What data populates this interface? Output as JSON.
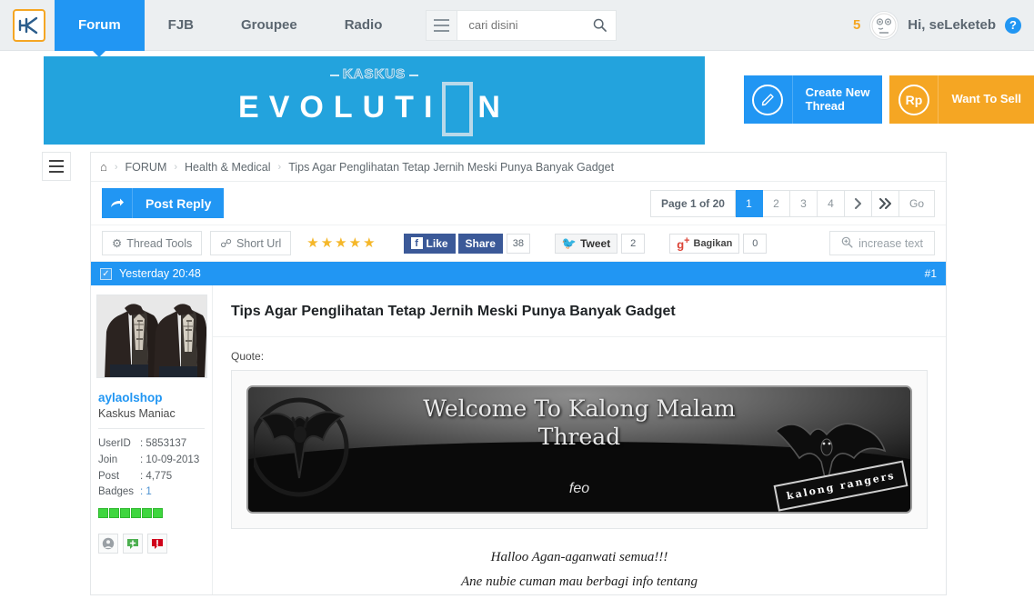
{
  "topnav": {
    "logo_alt": "KASKUS",
    "items": [
      {
        "label": "Forum",
        "active": true
      },
      {
        "label": "FJB",
        "active": false
      },
      {
        "label": "Groupee",
        "active": false
      },
      {
        "label": "Radio",
        "active": false
      }
    ],
    "menu_icon": "hamburger-icon",
    "search": {
      "value": "",
      "placeholder": "cari disini",
      "icon": "search-icon"
    },
    "notification_count": "5",
    "greeting": "Hi, seLeketeb",
    "help_label": "?",
    "avatar_icon": "user-avatar-icon"
  },
  "banner": {
    "brand_small": "KASKUS",
    "title_part1": "EVOLUTI",
    "title_part2": "N",
    "bg_color": "#23a3dd"
  },
  "actions": {
    "create_thread": {
      "label": "Create New\nThread",
      "line1": "Create New",
      "line2": "Thread",
      "icon": "pencil-icon",
      "color": "#2196f3"
    },
    "want_to_sell": {
      "label": "Want To Sell",
      "icon": "rupiah-icon",
      "icon_text": "Rp",
      "color": "#f5a623"
    }
  },
  "sidebar_toggle_icon": "hamburger-icon",
  "breadcrumb": {
    "home_icon": "home-icon",
    "items": [
      "FORUM",
      "Health & Medical",
      "Tips Agar Penglihatan Tetap Jernih Meski Punya Banyak Gadget"
    ],
    "separator": "›"
  },
  "toolbar": {
    "post_reply": {
      "label": "Post Reply",
      "icon": "reply-arrow-icon"
    },
    "pager": {
      "info": "Page 1 of 20",
      "pages": [
        "1",
        "2",
        "3",
        "4"
      ],
      "active_page": "1",
      "next_icon": "❯",
      "last_icon": "➤➤",
      "go_label": "Go"
    },
    "thread_tools": {
      "label": "Thread Tools",
      "icon": "gear-icon"
    },
    "short_url": {
      "label": "Short Url",
      "icon": "link-icon"
    },
    "rating": {
      "stars": 5,
      "filled": 5,
      "color": "#f5b729"
    },
    "facebook": {
      "like_label": "Like",
      "share_label": "Share",
      "count": "38",
      "icon": "facebook-icon"
    },
    "twitter": {
      "label": "Tweet",
      "count": "2",
      "icon": "twitter-icon"
    },
    "google": {
      "label": "Bagikan",
      "count": "0",
      "icon": "google-plus-icon"
    },
    "increase_text": {
      "label": "increase text",
      "icon": "zoom-in-icon"
    }
  },
  "post": {
    "header": {
      "timestamp": "Yesterday 20:48",
      "number": "#1",
      "check_icon": "checkbox-checked-icon"
    },
    "user": {
      "avatar_alt": "two men wearing dark leather jackets",
      "username": "aylaolshop",
      "rank": "Kaskus Maniac",
      "stats": [
        {
          "key": "UserID",
          "value": ": 5853137",
          "link": false
        },
        {
          "key": "Join",
          "value": ": 10-09-2013",
          "link": false
        },
        {
          "key": "Post",
          "value": ": 4,775",
          "link": false
        },
        {
          "key": "Badges",
          "value": ": 1",
          "link": true
        }
      ],
      "reputation_bars": 6,
      "reputation_color": "#3ed63e",
      "action_icons": [
        {
          "name": "profile-icon",
          "color": "#9aa0a5"
        },
        {
          "name": "add-reputation-icon",
          "color": "#4caf50"
        },
        {
          "name": "report-post-icon",
          "color": "#d0021b"
        }
      ]
    },
    "title": "Tips Agar Penglihatan Tetap Jernih Meski Punya Banyak Gadget",
    "quote_label": "Quote:",
    "quote_image": {
      "alt": "kalong malam thread banner",
      "line1": "Welcome To Kalong Malam",
      "line2": "Thread",
      "signature": "feo",
      "tag": "kalong rangers"
    },
    "body_lines": [
      "Halloo Agan-aganwati semua!!!",
      "Ane nubie cuman mau berbagi info tentang"
    ]
  }
}
